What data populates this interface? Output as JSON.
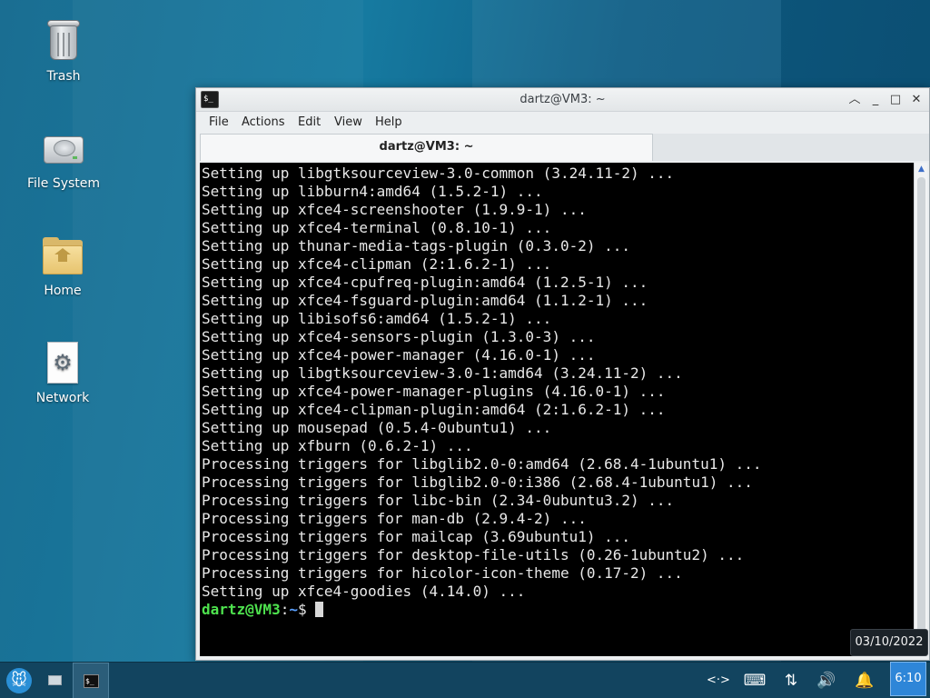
{
  "desktop": {
    "icons": [
      {
        "label": "Trash",
        "icon": "trash-icon"
      },
      {
        "label": "File System",
        "icon": "drive-icon"
      },
      {
        "label": "Home",
        "icon": "home-folder-icon"
      },
      {
        "label": "Network",
        "icon": "network-icon"
      }
    ]
  },
  "window": {
    "title": "dartz@VM3: ~",
    "menu": [
      "File",
      "Actions",
      "Edit",
      "View",
      "Help"
    ],
    "tab_label": "dartz@VM3: ~",
    "controls": {
      "shade": "chevron-up-icon",
      "minimize": "minimize-icon",
      "maximize": "maximize-icon",
      "close": "close-icon"
    }
  },
  "terminal": {
    "lines": [
      "Setting up libgtksourceview-3.0-common (3.24.11-2) ...",
      "Setting up libburn4:amd64 (1.5.2-1) ...",
      "Setting up xfce4-screenshooter (1.9.9-1) ...",
      "Setting up xfce4-terminal (0.8.10-1) ...",
      "Setting up thunar-media-tags-plugin (0.3.0-2) ...",
      "Setting up xfce4-clipman (2:1.6.2-1) ...",
      "Setting up xfce4-cpufreq-plugin:amd64 (1.2.5-1) ...",
      "Setting up xfce4-fsguard-plugin:amd64 (1.1.2-1) ...",
      "Setting up libisofs6:amd64 (1.5.2-1) ...",
      "Setting up xfce4-sensors-plugin (1.3.0-3) ...",
      "Setting up xfce4-power-manager (4.16.0-1) ...",
      "Setting up libgtksourceview-3.0-1:amd64 (3.24.11-2) ...",
      "Setting up xfce4-power-manager-plugins (4.16.0-1) ...",
      "Setting up xfce4-clipman-plugin:amd64 (2:1.6.2-1) ...",
      "Setting up mousepad (0.5.4-0ubuntu1) ...",
      "Setting up xfburn (0.6.2-1) ...",
      "Processing triggers for libglib2.0-0:amd64 (2.68.4-1ubuntu1) ...",
      "Processing triggers for libglib2.0-0:i386 (2.68.4-1ubuntu1) ...",
      "Processing triggers for libc-bin (2.34-0ubuntu3.2) ...",
      "Processing triggers for man-db (2.9.4-2) ...",
      "Processing triggers for mailcap (3.69ubuntu1) ...",
      "Processing triggers for desktop-file-utils (0.26-1ubuntu2) ...",
      "Processing triggers for hicolor-icon-theme (0.17-2) ...",
      "Setting up xfce4-goodies (4.14.0) ..."
    ],
    "prompt": {
      "user": "dartz@VM3",
      "sep": ":",
      "path": "~",
      "suffix": "$ "
    }
  },
  "taskbar": {
    "tray": {
      "network": "<·>",
      "keyboard": "keyboard-icon",
      "transfer": "arrows-updown-icon",
      "volume": "volume-icon",
      "notifications": "bell-icon"
    },
    "clock": "6:10",
    "tooltip": "03/10/2022"
  },
  "colors": {
    "prompt_user": "#4ee24e",
    "prompt_path": "#5aa0ff",
    "clock_bg": "#2e86d8",
    "panel_bg": "#12445f"
  }
}
